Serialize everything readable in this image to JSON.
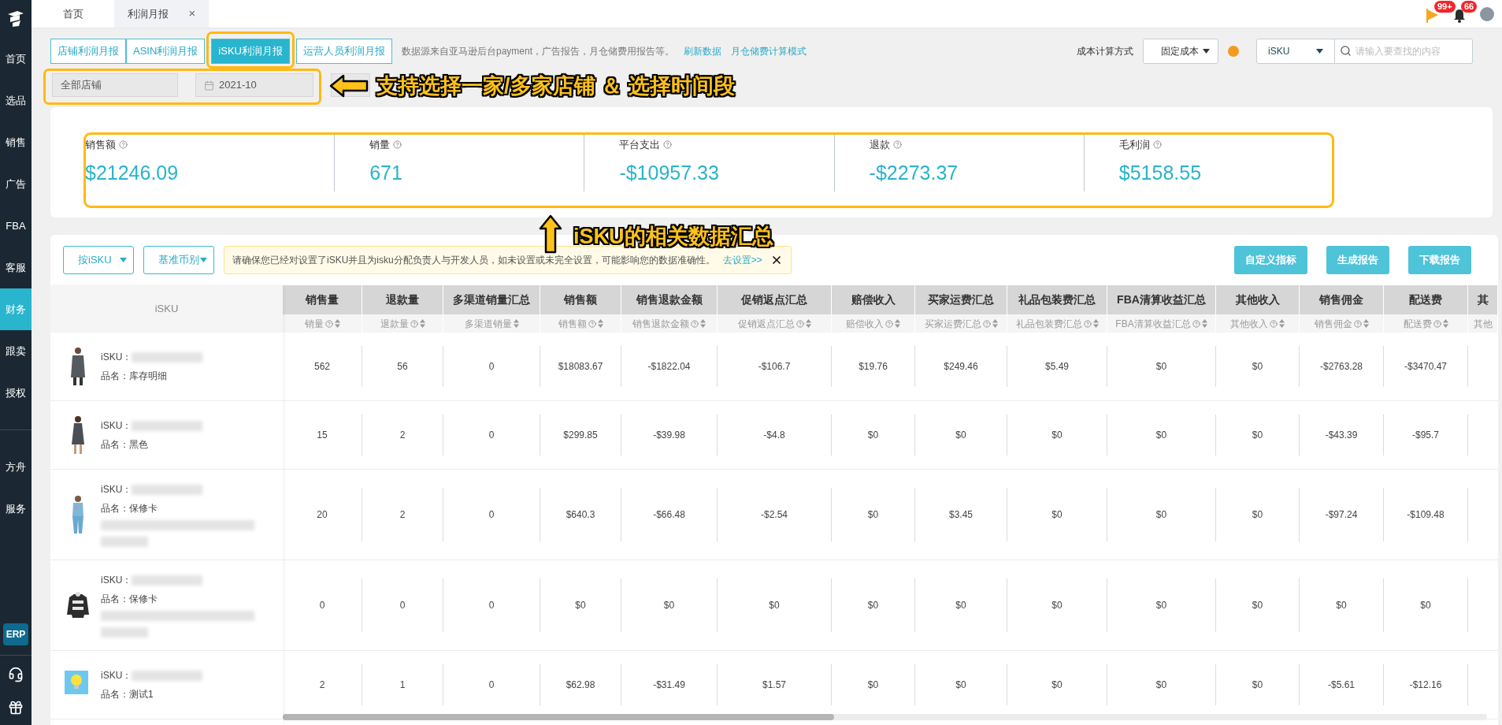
{
  "sidebar": {
    "items": [
      {
        "label": "首页",
        "selected": false
      },
      {
        "label": "选品",
        "selected": false
      },
      {
        "label": "销售",
        "selected": false
      },
      {
        "label": "广告",
        "selected": false
      },
      {
        "label": "FBA",
        "selected": false
      },
      {
        "label": "客服",
        "selected": false
      },
      {
        "label": "财务",
        "selected": true
      },
      {
        "label": "跟卖",
        "selected": false
      },
      {
        "label": "授权",
        "selected": false
      }
    ],
    "extra_items": [
      {
        "label": "方舟",
        "selected": false
      },
      {
        "label": "服务",
        "selected": false
      }
    ],
    "erp": "ERP"
  },
  "page_tabs": [
    {
      "label": "首页",
      "selected": false,
      "closable": false
    },
    {
      "label": "利润月报",
      "selected": true,
      "closable": true
    }
  ],
  "close_glyph": "×",
  "notifications": [
    {
      "kind": "flag",
      "badge": "99+"
    },
    {
      "kind": "bell",
      "badge": "66"
    }
  ],
  "report_tabs": [
    {
      "label": "店铺利润月报",
      "selected": false
    },
    {
      "label": "ASIN利润月报",
      "selected": false
    },
    {
      "label": "iSKU利润月报",
      "selected": true
    },
    {
      "label": "运营人员利润月报",
      "selected": false
    }
  ],
  "source_note": "数据源来自亚马逊后台payment，广告报告，月仓储费用报告等。",
  "links": [
    "刷新数据",
    "月仓储费计算模式"
  ],
  "cost_method": {
    "label": "成本计算方式",
    "value": "固定成本"
  },
  "search": {
    "scope": "iSKU",
    "placeholder": "请输入要查找的内容"
  },
  "store_select": "全部店铺",
  "month": "2021-10",
  "summary": [
    {
      "label": "销售额",
      "value": "$21246.09"
    },
    {
      "label": "销量",
      "value": "671"
    },
    {
      "label": "平台支出",
      "value": "-$10957.33"
    },
    {
      "label": "退款",
      "value": "-$2273.37"
    },
    {
      "label": "毛利润",
      "value": "$5158.55"
    }
  ],
  "filters": [
    "按iSKU",
    "基准币别"
  ],
  "notice": {
    "text": "请确保您已经对设置了iSKU并且为isku分配负责人与开发人员，如未设置或未完全设置，可能影响您的数据准确性。",
    "link": "去设置>>"
  },
  "actions": [
    "自定义指标",
    "生成报告",
    "下载报告"
  ],
  "table": {
    "first_column": "iSKU",
    "columns": [
      {
        "title": "销售量",
        "sub": "销量",
        "help": true
      },
      {
        "title": "退款量",
        "sub": "退款量",
        "help": true
      },
      {
        "title": "多渠道销量汇总",
        "sub": "多渠道销量",
        "help": false
      },
      {
        "title": "销售额",
        "sub": "销售额",
        "help": true
      },
      {
        "title": "销售退款金额",
        "sub": "销售退款金额",
        "help": true
      },
      {
        "title": "促销返点汇总",
        "sub": "促销返点汇总",
        "help": true
      },
      {
        "title": "赔偿收入",
        "sub": "赔偿收入",
        "help": true
      },
      {
        "title": "买家运费汇总",
        "sub": "买家运费汇总",
        "help": true
      },
      {
        "title": "礼品包装费汇总",
        "sub": "礼品包装费汇总",
        "help": true
      },
      {
        "title": "FBA清算收益汇总",
        "sub": "FBA清算收益汇总",
        "help": true
      },
      {
        "title": "其他收入",
        "sub": "其他收入",
        "help": true
      },
      {
        "title": "销售佣金",
        "sub": "销售佣金",
        "help": true
      },
      {
        "title": "配送费",
        "sub": "配送费",
        "help": true
      },
      {
        "title": "其",
        "sub": "其他",
        "help": false
      }
    ],
    "rows": [
      {
        "sku_label": "iSKU：",
        "name": "品名：库存明细",
        "has_details": false,
        "cells": [
          "562",
          "56",
          "0",
          "$18083.67",
          "-$1822.04",
          "-$106.7",
          "$19.76",
          "$249.46",
          "$5.49",
          "$0",
          "$0",
          "-$2763.28",
          "-$3470.47"
        ]
      },
      {
        "sku_label": "iSKU：",
        "name": "品名：黑色",
        "has_details": false,
        "cells": [
          "15",
          "2",
          "0",
          "$299.85",
          "-$39.98",
          "-$4.8",
          "$0",
          "$0",
          "$0",
          "$0",
          "$0",
          "-$43.39",
          "-$95.7"
        ]
      },
      {
        "sku_label": "iSKU：",
        "name": "品名：保修卡",
        "has_details": true,
        "cells": [
          "20",
          "2",
          "0",
          "$640.3",
          "-$66.48",
          "-$2.54",
          "$0",
          "$3.45",
          "$0",
          "$0",
          "$0",
          "-$97.24",
          "-$109.48"
        ]
      },
      {
        "sku_label": "iSKU：",
        "name": "品名：保修卡",
        "has_details": true,
        "cells": [
          "0",
          "0",
          "0",
          "$0",
          "$0",
          "$0",
          "$0",
          "$0",
          "$0",
          "$0",
          "$0",
          "$0",
          "$0"
        ]
      },
      {
        "sku_label": "iSKU：",
        "name": "品名：测试1",
        "has_details": false,
        "cells": [
          "2",
          "1",
          "0",
          "$62.98",
          "-$31.49",
          "$1.57",
          "$0",
          "$0",
          "$0",
          "$0",
          "$0",
          "-$5.61",
          "-$12.16"
        ]
      }
    ]
  },
  "annotations": [
    {
      "text": "支持选择一家/多家店铺 ＆ 选择时间段"
    },
    {
      "text": "iSKU的相关数据汇总"
    }
  ]
}
